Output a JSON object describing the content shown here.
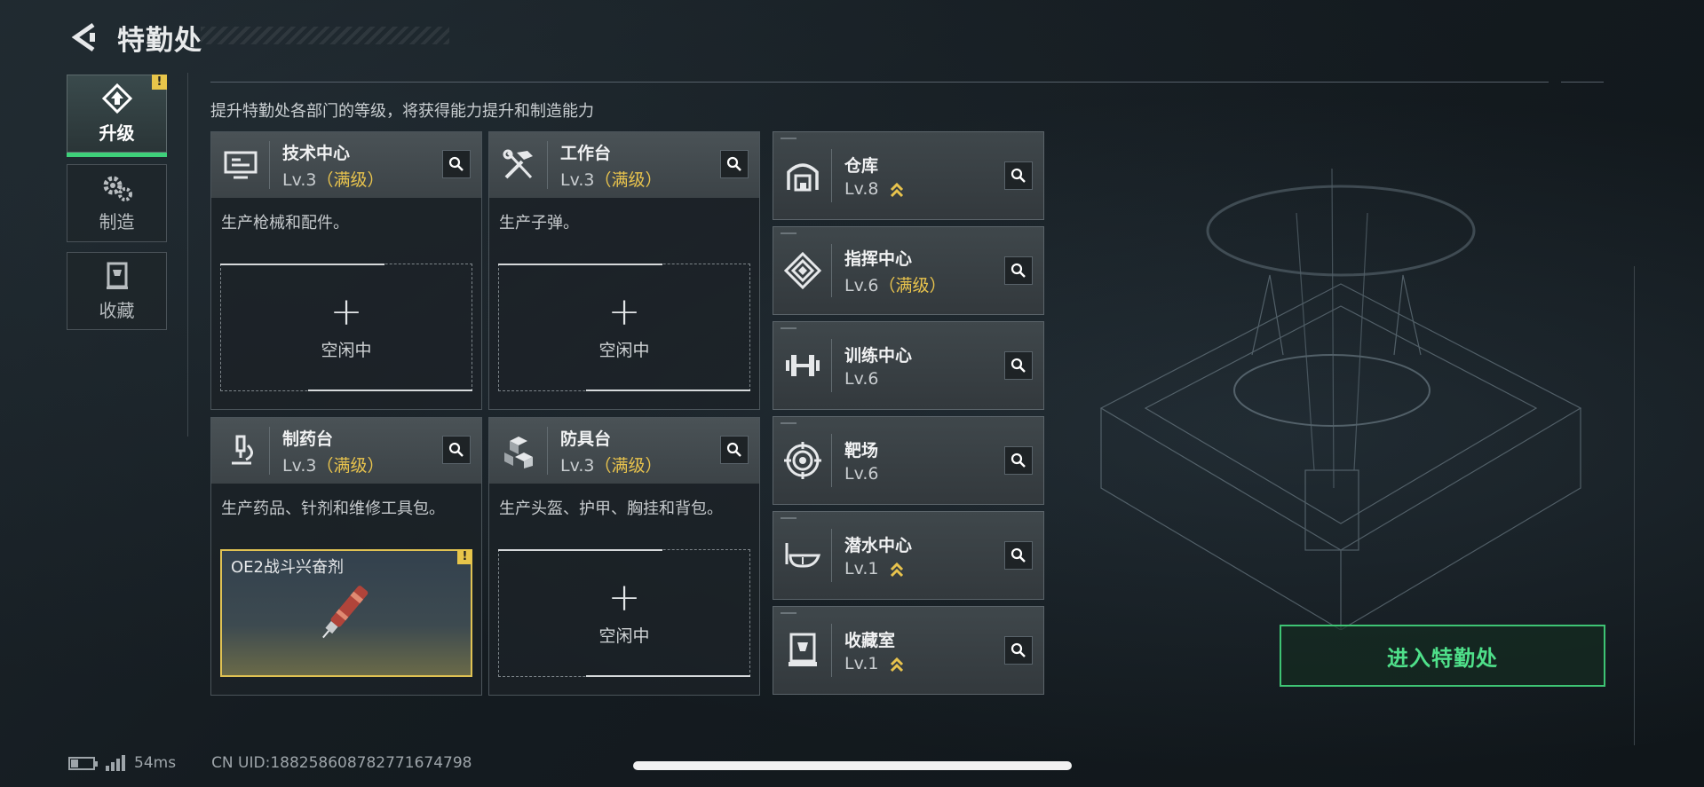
{
  "header": {
    "title": "特勤处"
  },
  "sidebar": {
    "items": [
      {
        "label": "升级",
        "icon": "upgrade-icon",
        "active": true,
        "badge": "!"
      },
      {
        "label": "制造",
        "icon": "gears-icon",
        "active": false
      },
      {
        "label": "收藏",
        "icon": "trophy-case-icon",
        "active": false
      }
    ]
  },
  "main": {
    "subtitle": "提升特勤处各部门的等级，将获得能力提升和制造能力",
    "workshops": [
      {
        "name": "技术中心",
        "level": "Lv.3",
        "maxed": "（满级）",
        "icon": "monitor-icon",
        "desc": "生产枪械和配件。",
        "slot": {
          "plus": "+",
          "text": "空闲中"
        }
      },
      {
        "name": "工作台",
        "level": "Lv.3",
        "maxed": "（满级）",
        "icon": "tools-icon",
        "desc": "生产子弹。",
        "slot": {
          "plus": "+",
          "text": "空闲中"
        }
      },
      {
        "name": "制药台",
        "level": "Lv.3",
        "maxed": "（满级）",
        "icon": "microscope-icon",
        "desc": "生产药品、针剂和维修工具包。",
        "slot": {
          "item": "OE2战斗兴奋剂",
          "badge": "!"
        }
      },
      {
        "name": "防具台",
        "level": "Lv.3",
        "maxed": "（满级）",
        "icon": "cubes-icon",
        "desc": "生产头盔、护甲、胸挂和背包。",
        "slot": {
          "plus": "+",
          "text": "空闲中"
        }
      }
    ],
    "facilities": [
      {
        "name": "仓库",
        "level": "Lv.8",
        "maxed": "",
        "upgradable": true,
        "icon": "warehouse-icon"
      },
      {
        "name": "指挥中心",
        "level": "Lv.6",
        "maxed": "（满级）",
        "upgradable": false,
        "icon": "command-icon"
      },
      {
        "name": "训练中心",
        "level": "Lv.6",
        "maxed": "",
        "upgradable": false,
        "icon": "dumbbell-icon"
      },
      {
        "name": "靶场",
        "level": "Lv.6",
        "maxed": "",
        "upgradable": false,
        "icon": "target-icon"
      },
      {
        "name": "潜水中心",
        "level": "Lv.1",
        "maxed": "",
        "upgradable": true,
        "icon": "diving-mask-icon"
      },
      {
        "name": "收藏室",
        "level": "Lv.1",
        "maxed": "",
        "upgradable": true,
        "icon": "display-case-icon"
      }
    ],
    "enter_button": "进入特勤处"
  },
  "status_bar": {
    "ping": "54ms",
    "uid": "CN UID:18825860878277167479​8"
  },
  "colors": {
    "accent_green": "#3ed07a",
    "maxed_gold": "#e8c34d",
    "warning": "#e7c54a"
  }
}
